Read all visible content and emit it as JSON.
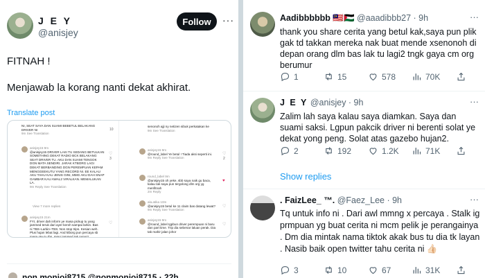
{
  "left": {
    "author_name": "J E Y",
    "author_handle": "@anisjey",
    "follow_label": "Follow",
    "more_glyph": "···",
    "line1": "FITNAH !",
    "line2": "Menjawab la korang nanti dekat akhirat.",
    "translate_label": "Translate post",
    "embedded": {
      "c1": [
        {
          "text": "NI, SEAT SAYA DAN SUAMI BEBETUL BELAKANG DRIVER NI",
          "meta": "9m  See Translation",
          "num": "10"
        },
        {
          "user": "anisjey15 9m",
          "text": "@anisjey15 DRIVER LAKI TU SEDANG BETULKAN SOMETHING DEKAT RADIO BCK BELAKANG SEAT DRIVER TU. AKU DAN SUAMI TENGOK DGN MATA SENDIRI. JARAK KTBORG LAGI DEKAT BERBANDING DGN PEREMPUAN KEPAM MENGGEEKUTU YANG RECORD NI. EE KALAU AKU TAHU KAU JENIS GINI, MMG AKU DAH SNAP GAMBAR KAU AWAL2 VIRALKAN. MEMALUKAN LA.",
          "meta": "9m  Reply  See Translation",
          "num": "3"
        },
        {
          "text": "View 7 more replies",
          "meta": "",
          "num": ""
        },
        {
          "user": "anisjey15 21m",
          "text": "FYI, driver dah inform ye masa pickup tu yang jammed teruk dari ayer keroh sampai larkin. Bas ni TBS–Larkin–TBS. Non stop trips. Kesian weh. Plus hujan lebat lagi. And ktborg pun percaya sb masa otw tu tbs, mmg jammed tak putus2 opposite jalan. Video ni tak sampai 30minit lagi gerak dari larkin",
          "meta": "",
          "num": ""
        }
      ],
      "c2": [
        {
          "text": "senonoh ajji ny netizen sibuk perkatakan ke",
          "meta": "9m  See Translation",
          "num": ""
        },
        {
          "user": "anisjey15 9m",
          "text": "@round_label Ye betul ! Tiada aksi seperti ini.",
          "meta": "9m  Reply  See Translation",
          "num": "2"
        },
        {
          "user": "round_label 9m",
          "text": "@anisjey15 oh yeke, sbb saya naik gu baca, kalau tak saya pun tergolong dlm org yg menfitnah",
          "meta": "2m  Reply",
          "num": ""
        },
        {
          "user": "ala.atika 10m",
          "text": "@anisjey15 betul ke 11 claim bas datang lewat?",
          "meta": "9m  Reply  See Translation",
          "num": ""
        },
        {
          "user": "anisjey15 9m",
          "text": "@round_label Igpbun driver perempuan ni baru dan part time. Trip dia sebenar laluan perak. Dia tak mahir jalan johor",
          "meta": "",
          "num": ""
        }
      ]
    },
    "bottom_name": "non monioi8715 @nonmonioi8715 · 22h"
  },
  "tweets": [
    {
      "name": "Aadibbbbbb",
      "flags": "🇲🇾🇵🇸",
      "handle": "@aaadibbb27 · 9h",
      "text": "thank you share cerita yang betul kak,saya pun plik gak td takkan mereka nak buat mende xsenonoh di depan orang dlm bas lak tu lagi2 tngk gaya cm org berumur",
      "replies": "1",
      "reposts": "15",
      "likes": "578",
      "views": "70K"
    },
    {
      "name": "J E Y",
      "handle": "@anisjey · 9h",
      "text": "Zalim lah saya kalau saya diamkan. Saya dan suami saksi. Lgpun pakcik driver ni berenti solat ye dekat yong peng. Solat atas gazebo hujan2.",
      "replies": "2",
      "reposts": "192",
      "likes": "1.2K",
      "views": "71K"
    },
    {
      "name": ". FaizLee_ ™.",
      "handle": "@Faez_Lee · 9h",
      "text": "Tq untuk info ni . Dari awl mmng x percaya . Stalk ig prmpuan yg buat cerita ni mcm pelik je perangainya . Dm dia mintak nama tiktok akak bus tu dia tk layan . Nasib baik open twitter tahu cerita ni 👍🏻",
      "replies": "3",
      "reposts": "10",
      "likes": "67",
      "views": "31K"
    }
  ],
  "show_replies": "Show replies"
}
